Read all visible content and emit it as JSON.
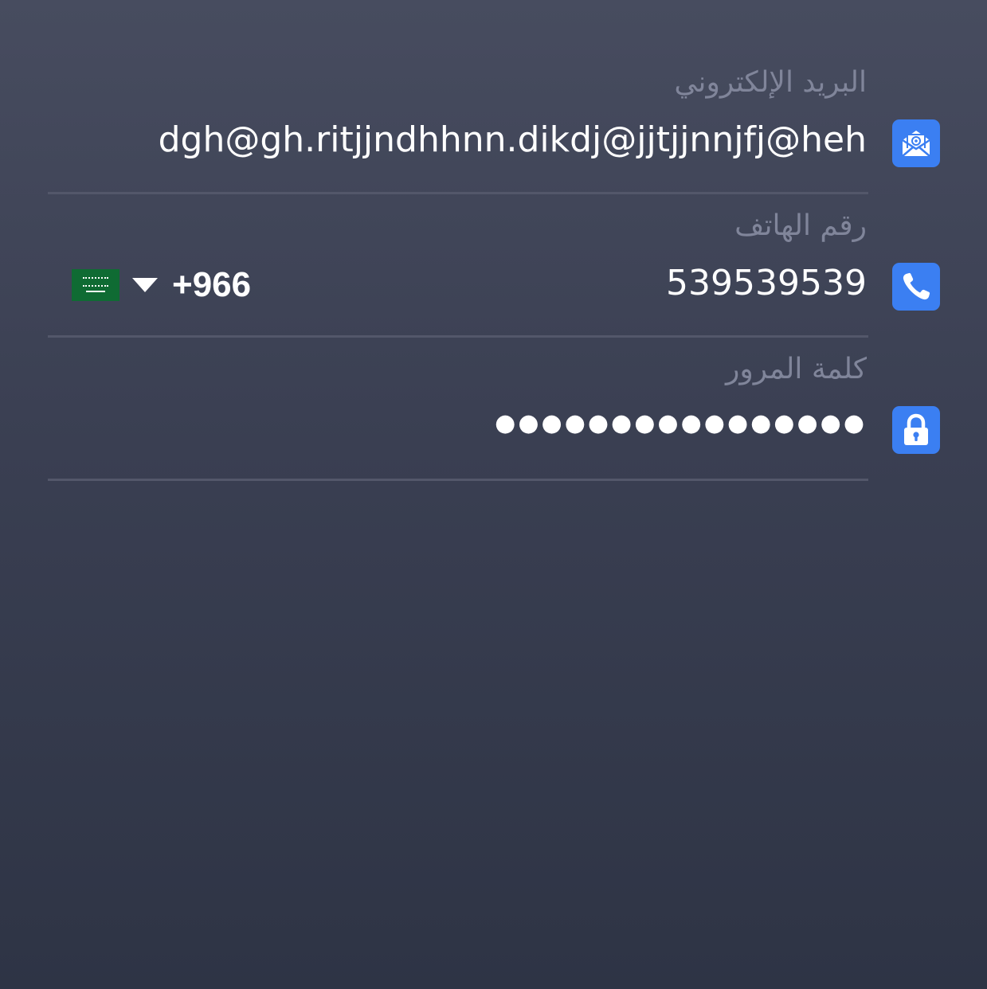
{
  "form": {
    "email": {
      "label": "البريد الإلكتروني",
      "value": "dgh@gh.ritjjndhhnn.dikdj@jjtjjnnjfj@heh",
      "icon": "envelope-at-icon"
    },
    "phone": {
      "label": "رقم الهاتف",
      "value": "539539539",
      "icon": "phone-icon",
      "country": {
        "flag": "saudi-arabia-flag-icon",
        "dial_code": "+966"
      }
    },
    "password": {
      "label": "كلمة المرور",
      "value": "●●●●●●●●●●●●●●●●",
      "icon": "lock-icon"
    }
  },
  "colors": {
    "accent": "#3b7ff2",
    "label": "#80859a",
    "divider": "#53576a",
    "flag_green": "#0f6b33"
  }
}
